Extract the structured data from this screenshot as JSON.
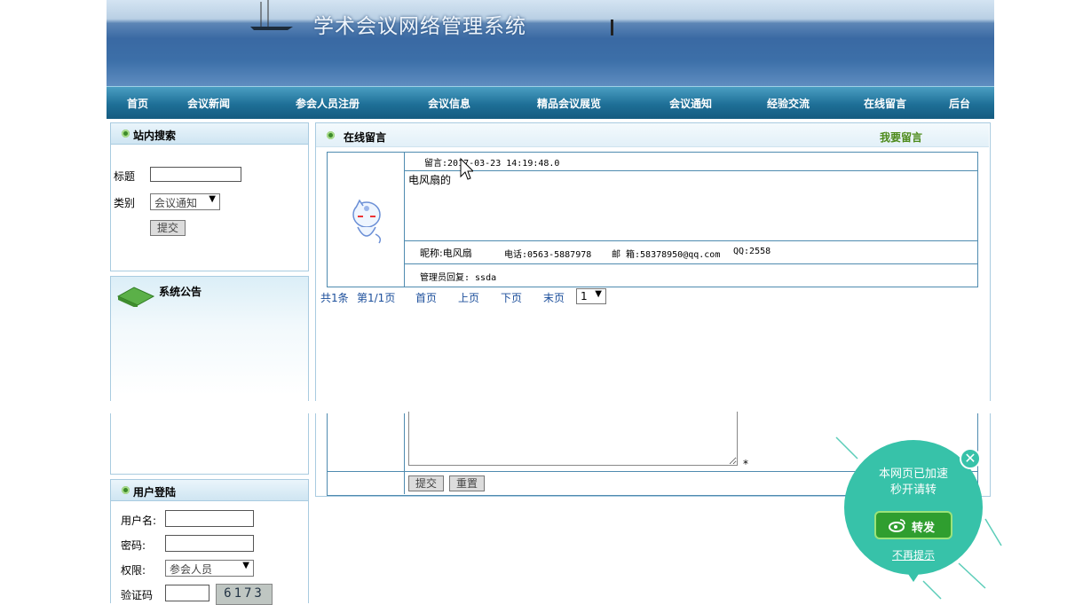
{
  "header": {
    "site_title": "学术会议网络管理系统"
  },
  "nav": {
    "items": [
      "首页",
      "会议新闻",
      "参会人员注册",
      "会议信息",
      "精品会议展览",
      "会议通知",
      "经验交流",
      "在线留言",
      "后台"
    ]
  },
  "search_panel": {
    "title": "站内搜索",
    "title_label": "标题",
    "category_label": "类别",
    "category_value": "会议通知",
    "submit_label": "提交"
  },
  "notice_panel": {
    "title": "系统公告"
  },
  "login_panel": {
    "title": "用户登陆",
    "username_label": "用户名:",
    "password_label": "密码:",
    "role_label": "权限:",
    "role_value": "参会人员",
    "captcha_label": "验证码",
    "captcha_value": "6173"
  },
  "main": {
    "title": "在线留言",
    "post_link": "我要留言",
    "message": {
      "header": "留言:2017-03-23 14:19:48.0",
      "body": "电风扇的",
      "nickname": "昵称:电风扇",
      "phone": "电话:0563-5887978",
      "email": "邮 箱:58378950@qq.com",
      "qq": "QQ:2558",
      "reply": "管理员回复: ssda"
    },
    "pagination": {
      "total": "共1条",
      "page": "第1/1页",
      "first": "首页",
      "prev": "上页",
      "next": "下页",
      "last": "末页",
      "select_value": "1"
    },
    "form": {
      "required_mark": "*",
      "submit_label": "提交",
      "reset_label": "重置"
    }
  },
  "popup": {
    "line1": "本网页已加速",
    "line2": "秒开请转",
    "share_label": "转发",
    "dismiss_label": "不再提示"
  },
  "colors": {
    "nav": "#1e6f97",
    "panel_border": "#a9cbe0",
    "popup": "#37c2a9",
    "link": "#1b4e9b",
    "post_link": "#4c8a1a"
  }
}
